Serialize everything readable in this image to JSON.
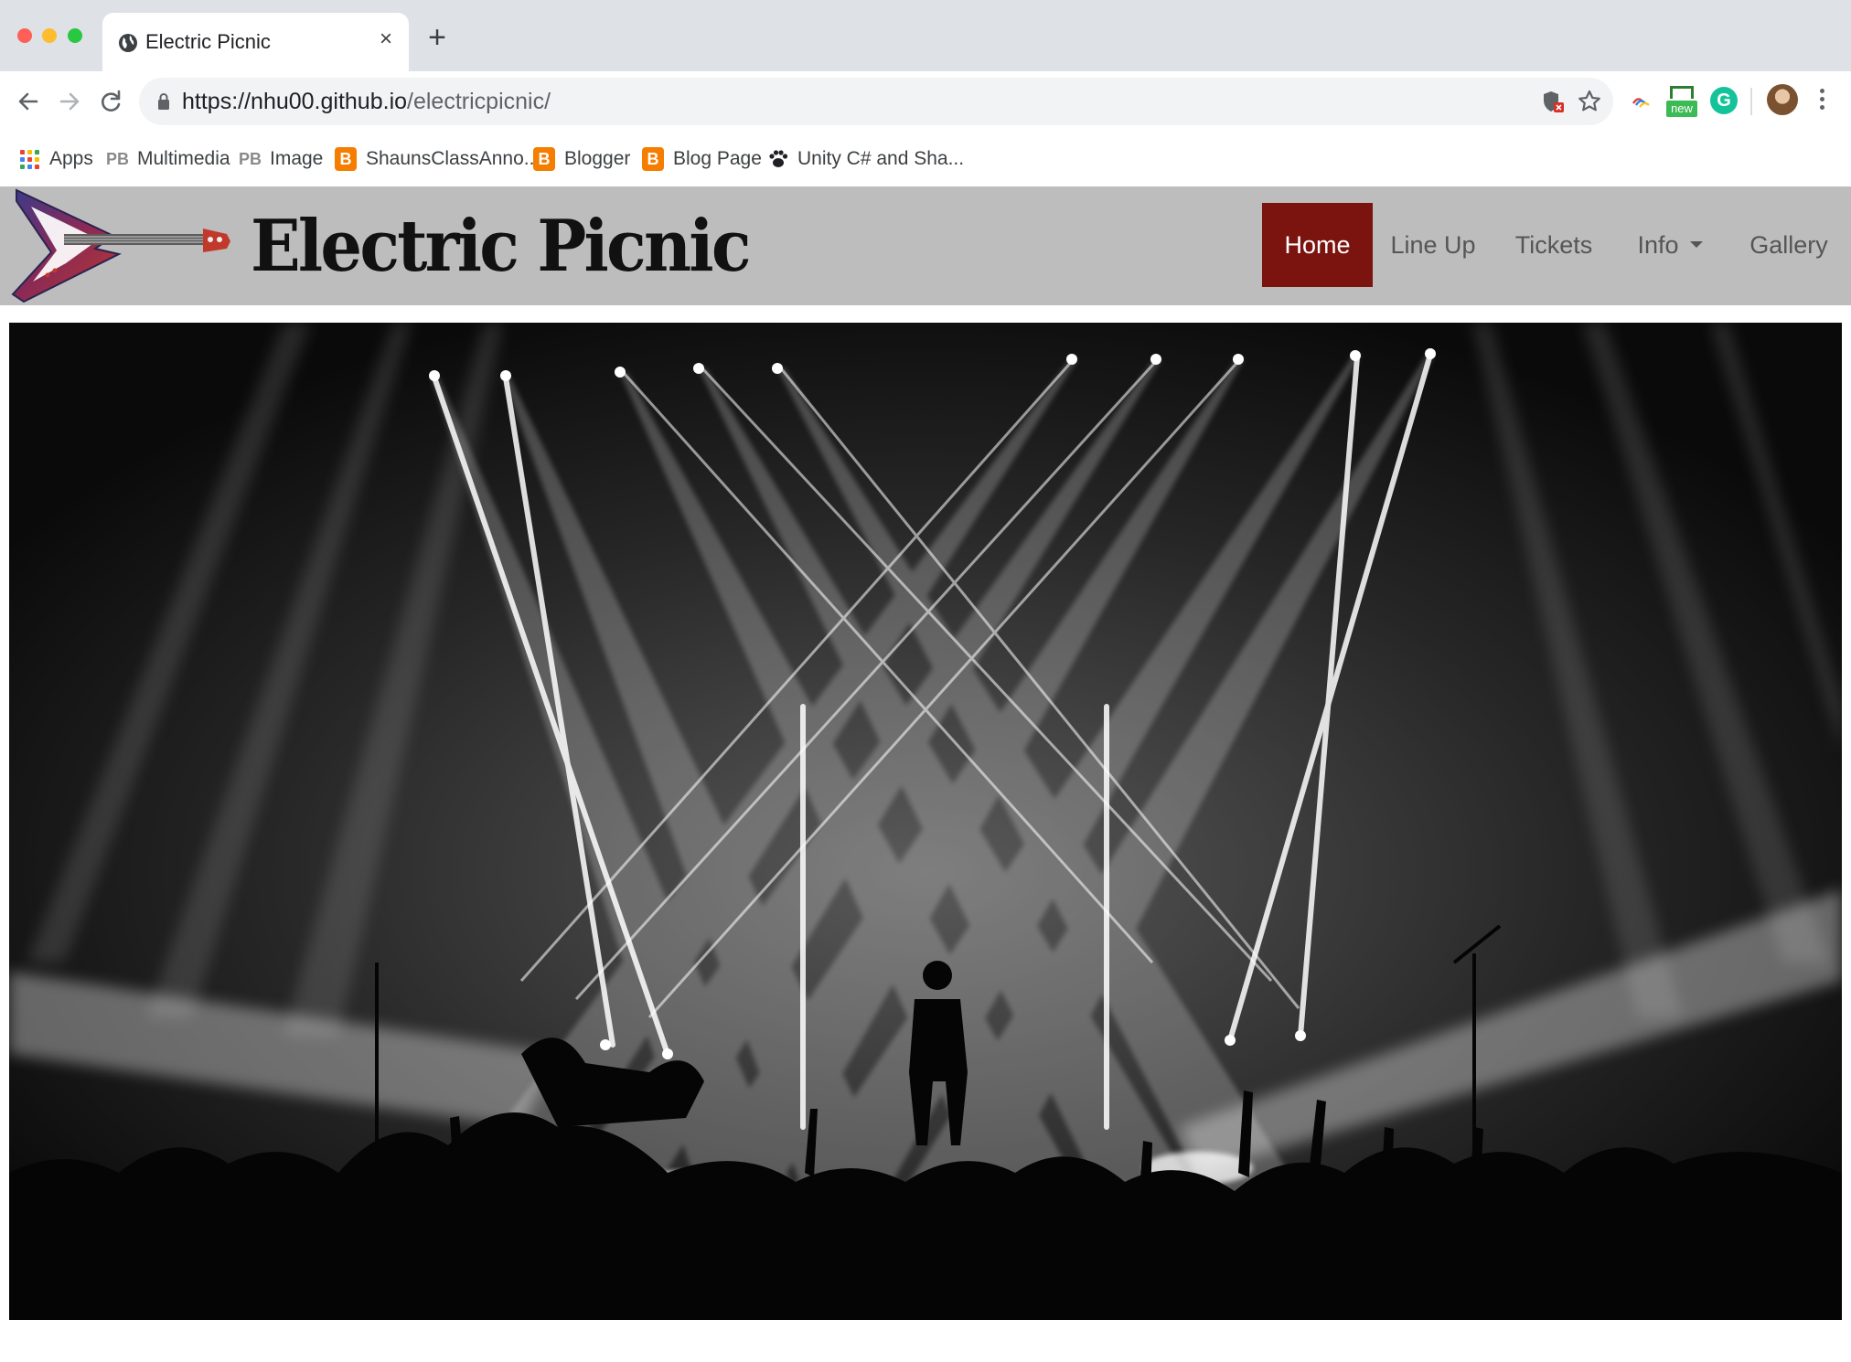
{
  "browser": {
    "tab_title": "Electric Picnic",
    "tab_close": "×",
    "new_tab": "+",
    "url_host": "https://nhu00.github.io",
    "url_path": "/electricpicnic/",
    "extension_badge": "new",
    "grammarly_letter": "G",
    "bookmarks": [
      {
        "label": "Apps",
        "icon": "apps-grid-icon"
      },
      {
        "label": "Multimedia",
        "icon": "pb-icon"
      },
      {
        "label": "Image",
        "icon": "pb-icon"
      },
      {
        "label": "ShaunsClassAnno...",
        "icon": "blogger-icon"
      },
      {
        "label": "Blogger",
        "icon": "blogger-icon"
      },
      {
        "label": "Blog Page",
        "icon": "blogger-icon"
      },
      {
        "label": "Unity C# and Sha...",
        "icon": "paw-icon"
      }
    ],
    "pb_text": "PB",
    "blogger_letter": "B"
  },
  "site": {
    "brand": "Electric Picnic",
    "nav": [
      {
        "label": "Home",
        "active": true
      },
      {
        "label": "Line Up"
      },
      {
        "label": "Tickets"
      },
      {
        "label": "Info",
        "dropdown": true
      },
      {
        "label": "Gallery"
      }
    ],
    "colors": {
      "navbar_bg": "#bdbdbd",
      "active_bg": "#7b130e",
      "brand_text": "#111111"
    }
  }
}
